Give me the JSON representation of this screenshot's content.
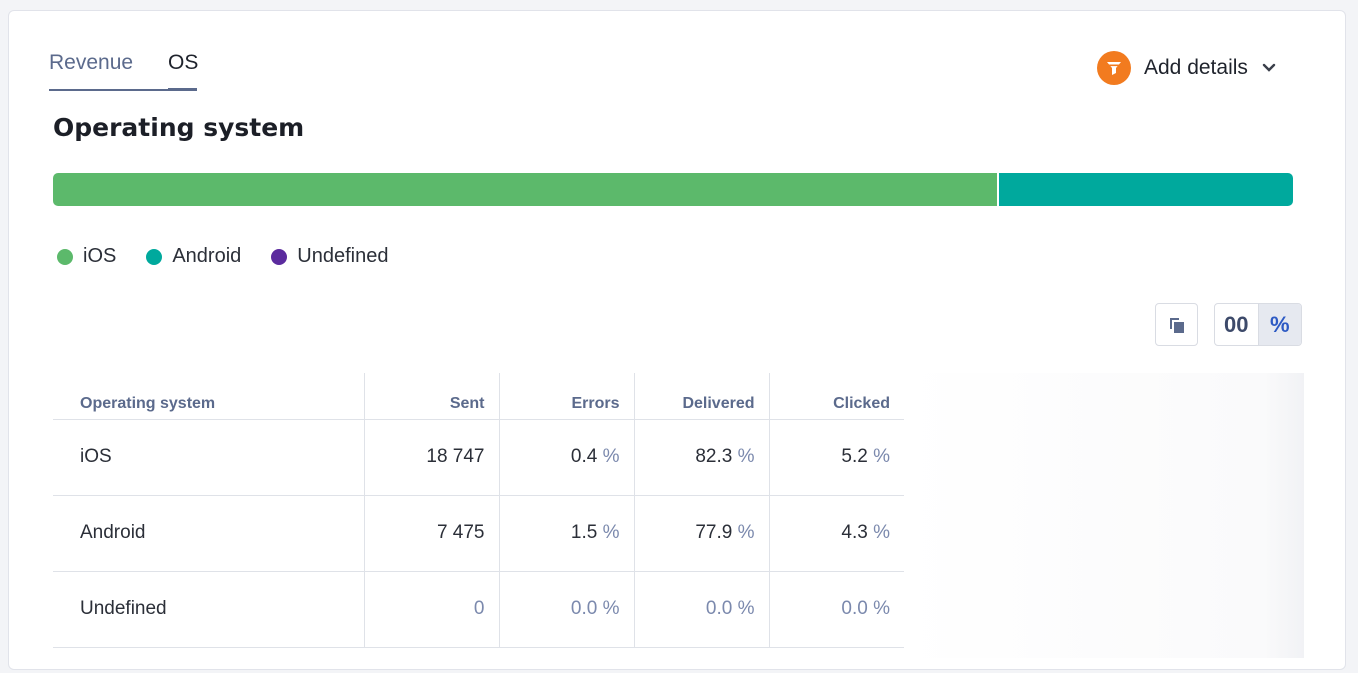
{
  "tabs": {
    "revenue": "Revenue",
    "os": "OS"
  },
  "add_details": {
    "label": "Add details",
    "icon": "funnel-icon",
    "badge_color": "#f27b1f"
  },
  "section_title": "Operating system",
  "breakdown": {
    "segments": [
      {
        "name": "iOS",
        "share": 0.7615,
        "color": "#5cb96b"
      },
      {
        "name": "Android",
        "share": 0.2385,
        "color": "#00a99d"
      },
      {
        "name": "Undefined",
        "share": 0.0,
        "color": "#5b2b9e"
      }
    ]
  },
  "legend": [
    {
      "label": "iOS",
      "color": "#5cb96b"
    },
    {
      "label": "Android",
      "color": "#00a99d"
    },
    {
      "label": "Undefined",
      "color": "#5b2b9e"
    }
  ],
  "controls": {
    "copy_icon": "copy-icon",
    "toggle_count": "00",
    "toggle_percent": "%"
  },
  "table": {
    "headers": {
      "os": "Operating system",
      "sent": "Sent",
      "errors": "Errors",
      "delivered": "Delivered",
      "clicked": "Clicked"
    },
    "pct_sign": "%",
    "rows": [
      {
        "os": "iOS",
        "sent": "18 747",
        "errors": "0.4",
        "delivered": "82.3",
        "clicked": "5.2"
      },
      {
        "os": "Android",
        "sent": "7 475",
        "errors": "1.5",
        "delivered": "77.9",
        "clicked": "4.3"
      },
      {
        "os": "Undefined",
        "sent": "0",
        "errors": "0.0",
        "delivered": "0.0",
        "clicked": "0.0"
      }
    ]
  }
}
